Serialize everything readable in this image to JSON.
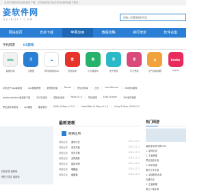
{
  "topbar": {
    "text": "多用户提供本地手机软件下载，手机软件官方和手机游戏的免费下载站"
  },
  "brand": {
    "title": "姿软件网",
    "url": "OZIROFT.COM"
  },
  "search": {
    "placeholder": "请输入您要搜索的内容"
  },
  "nav": {
    "items": [
      {
        "label": "网站首页"
      },
      {
        "label": "安卓下载"
      },
      {
        "label": "苹果应用"
      },
      {
        "label": "教程攻略"
      },
      {
        "label": "排行榜单"
      },
      {
        "label": "软件合集"
      }
    ],
    "active_index": 2
  },
  "section": {
    "tabs": [
      {
        "label": "手机网游"
      },
      {
        "label": "h5游戏"
      }
    ],
    "apps": [
      {
        "name": "鼎福优课",
        "icon_text": "otto",
        "color": "#f2f2f2",
        "text_color": "#1aa07a"
      },
      {
        "name": "汉服荟",
        "icon_text": "汉",
        "color": "#2a7fd4",
        "text_color": "#ffffff"
      },
      {
        "name": "手机网易盘app",
        "icon_text": "☁",
        "color": "#ffffff",
        "text_color": "#2a7fd4"
      },
      {
        "name": "壹伴易家",
        "icon_text": "壹",
        "color": "#e7332a",
        "text_color": "#ffffff"
      },
      {
        "name": "小乐趣游戏",
        "icon_text": "趣",
        "color": "#26b26b",
        "text_color": "#ffffff"
      },
      {
        "name": "电子竞赛",
        "icon_text": "竞",
        "color": "#2ab9c6",
        "text_color": "#ffffff"
      },
      {
        "name": "东方思维",
        "icon_text": "思",
        "color": "#d94a7a",
        "text_color": "#ffffff"
      },
      {
        "name": "空气质量指数",
        "icon_text": "A",
        "color": "#f2a23a",
        "text_color": "#ffffff"
      },
      {
        "name": "beeko",
        "icon_text": "beeko",
        "color": "#e92a5c",
        "text_color": "#ffffff"
      }
    ],
    "links_row1": [
      "手机盒子app最新版",
      "ppt模板教程",
      "夏夜轻松版",
      "Steam",
      "梦幻迪安卓",
      "云顶",
      "vivo Xtreme",
      "360软件管家"
    ],
    "links_row2": [
      "dadanyabaikcn最新版下载",
      "拉卡拉游戏",
      "国家安全部",
      "Resie v1.0",
      "梦幻极限",
      "Ekko Xtreme",
      "360软件管家"
    ],
    "links_row3": [
      "梦幻迪安卓游戏",
      "ppt模板",
      "酷我音乐",
      "EdStr Si Max v1.5.3",
      "LibreOffice Si Max v3.1.4",
      "Unity Si Max v2019.3.1"
    ]
  },
  "latest": {
    "heading": "最新更新",
    "category": "网络应用",
    "rows": [
      {
        "tag": "网络应用",
        "name": "迷你小交",
        "date": "2024-11-2"
      },
      {
        "tag": "网络应用",
        "name": "京东万象",
        "date": "2024-11-2"
      },
      {
        "tag": "网络应用",
        "name": "京东万象",
        "date": "2024-11-2"
      },
      {
        "tag": "网络应用",
        "name": "无风炫彩",
        "date": "2024-11-2"
      },
      {
        "tag": "网络应用",
        "name": "星际大师",
        "date": "2024-11-2"
      },
      {
        "tag": "网络应用",
        "name": "萌图画",
        "date": "2024-11-2"
      },
      {
        "tag": "网络应用",
        "name": "画图宝",
        "date": "2024-11-2"
      }
    ]
  },
  "hot": {
    "heading": "热门网游",
    "rows": [
      "最新游戏排行榜2024",
      "1. 原神手游",
      "2. 王者荣耀",
      "梦幻西游手游",
      "3. 和平精英",
      "明日方舟手游",
      "4. 英雄联盟手游",
      "光遇手游",
      "5. 王者荣耀",
      "第五人格手游"
    ]
  },
  "left": {
    "caption1": "幻塔手游 最新版",
    "caption2": "塔防三国志 最新版"
  }
}
